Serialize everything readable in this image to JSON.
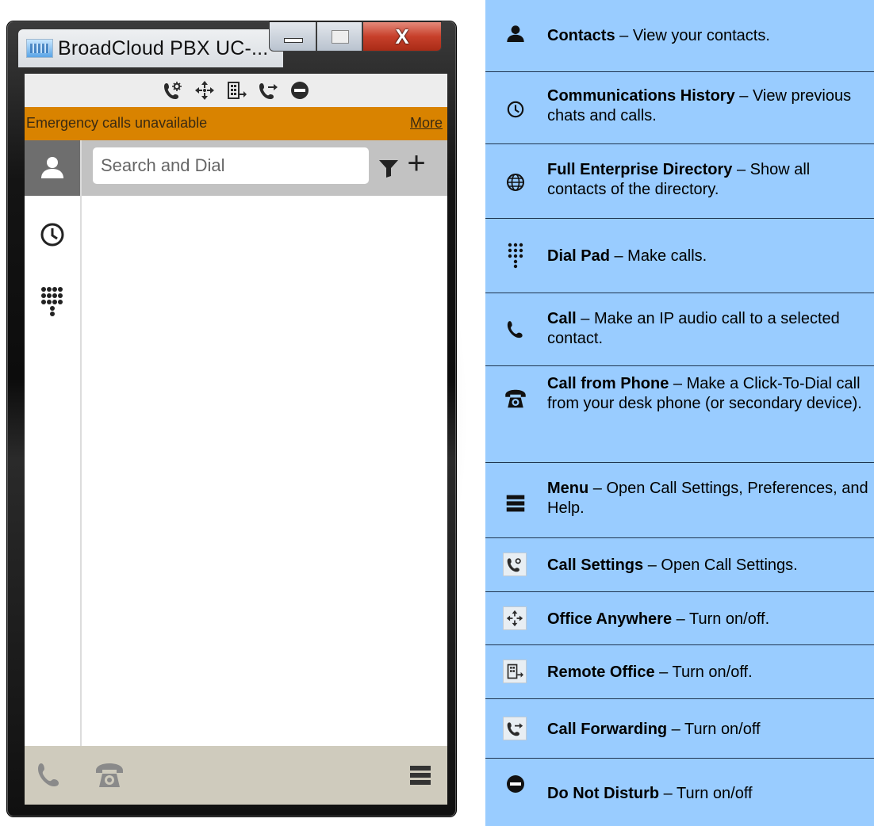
{
  "window": {
    "title": "BroadCloud PBX UC-...",
    "close_glyph": "X"
  },
  "toolbar": {
    "icons": [
      "call-settings-icon",
      "office-anywhere-icon",
      "remote-office-icon",
      "call-forwarding-icon",
      "do-not-disturb-icon"
    ]
  },
  "banner": {
    "text": "Emergency calls unavailable",
    "link": "More",
    "color": "#d98300"
  },
  "search": {
    "placeholder": "Search and Dial",
    "value": ""
  },
  "sidebar": {
    "tabs": [
      {
        "icon": "contacts-icon",
        "active": true
      },
      {
        "icon": "history-icon",
        "active": false
      },
      {
        "icon": "dialpad-icon",
        "active": false
      }
    ]
  },
  "bottom_bar": {
    "icons": [
      "call-icon",
      "call-from-phone-icon",
      "menu-icon"
    ]
  },
  "legend": {
    "background": "#99ccff",
    "sep": " – ",
    "items": [
      {
        "icon": "contacts-icon",
        "name": "Contacts",
        "desc": "View your contacts."
      },
      {
        "icon": "history-icon",
        "name": "Communications History",
        "desc": "View previous chats and calls."
      },
      {
        "icon": "globe-icon",
        "name": "Full Enterprise Directory",
        "desc": "Show all contacts of the directory."
      },
      {
        "icon": "dialpad-icon",
        "name": "Dial Pad",
        "desc": "Make calls."
      },
      {
        "icon": "call-icon",
        "name": "Call",
        "desc": "Make an IP audio call to a selected contact."
      },
      {
        "icon": "call-from-phone-icon",
        "name": "Call from Phone",
        "desc": "Make a Click-To-Dial call from your desk phone (or secondary device)."
      },
      {
        "icon": "menu-icon",
        "name": "Menu",
        "desc": "Open Call Settings, Preferences, and Help."
      },
      {
        "icon": "call-settings-icon",
        "name": "Call Settings",
        "desc": "Open Call Settings."
      },
      {
        "icon": "office-anywhere-icon",
        "name": "Office Anywhere",
        "desc": "Turn on/off."
      },
      {
        "icon": "remote-office-icon",
        "name": "Remote Office",
        "desc": "Turn on/off."
      },
      {
        "icon": "call-forwarding-icon",
        "name": "Call Forwarding",
        "desc": "Turn on/off"
      },
      {
        "icon": "do-not-disturb-icon",
        "name": "Do Not Disturb",
        "desc": "Turn on/off"
      }
    ]
  }
}
